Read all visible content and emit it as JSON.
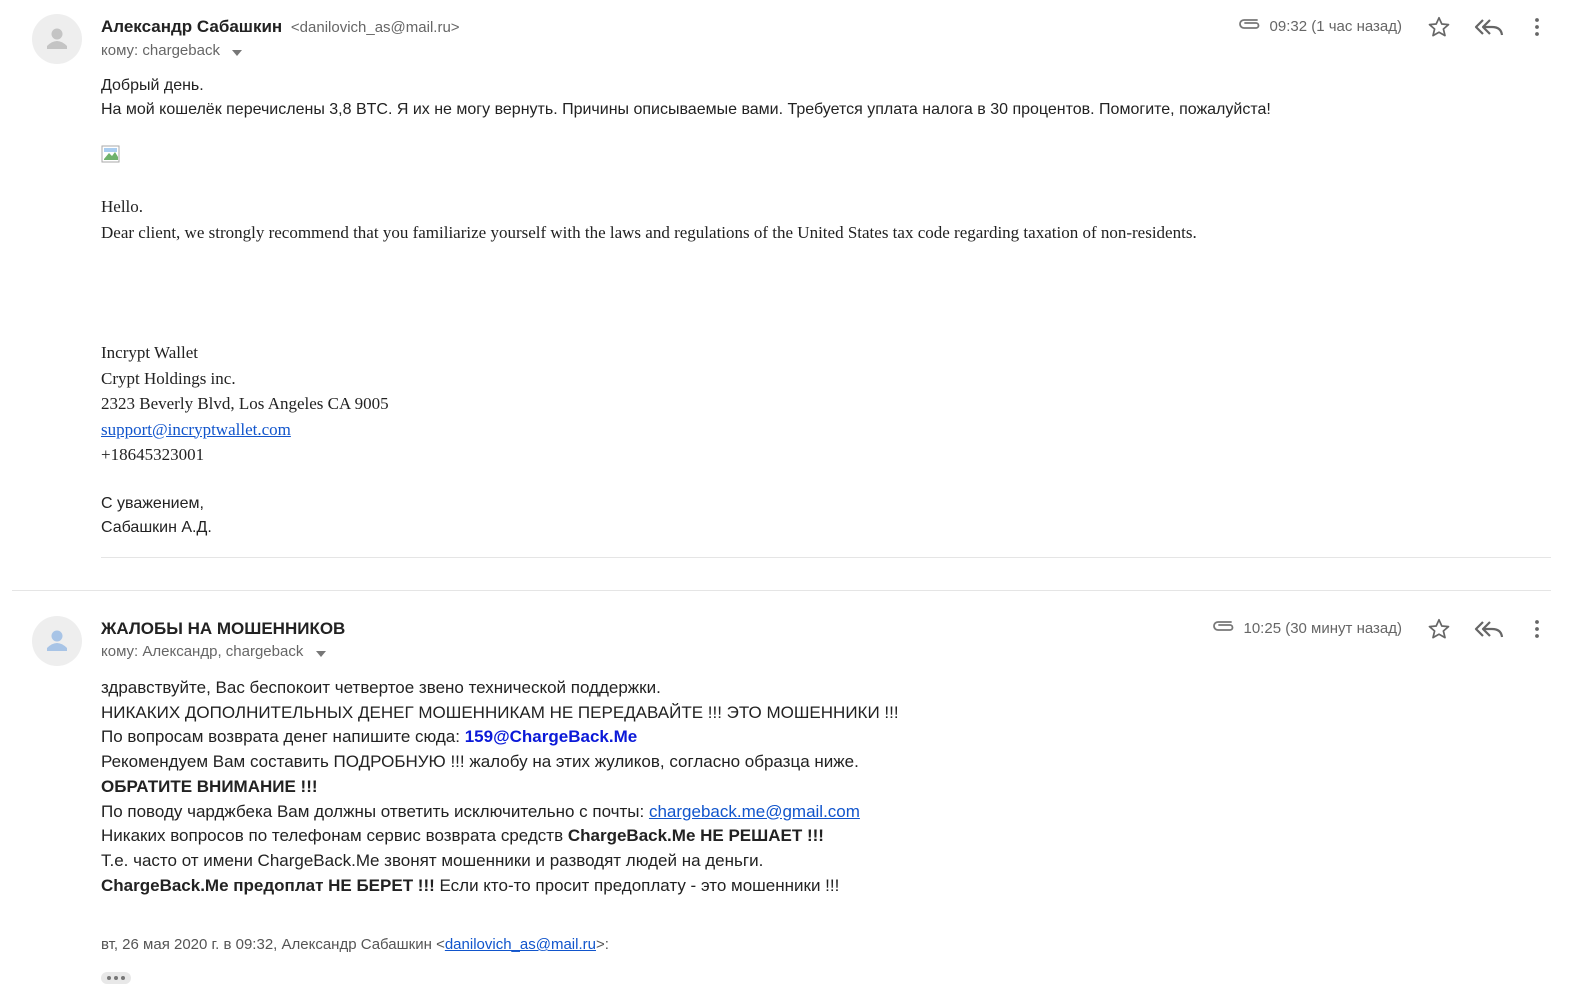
{
  "messages": [
    {
      "sender_name": "Александр Сабашкин",
      "sender_email": "<danilovich_as@mail.ru>",
      "recipients": "кому: chargeback",
      "time": "09:32 (1 час назад)",
      "body_ru": [
        "Добрый день.",
        "На мой кошелёк перечислены 3,8 BTC. Я их не могу вернуть. Причины описываемые вами. Требуется уплата налога в 30 процентов. Помогите, пожалуйста!"
      ],
      "body_en": [
        "Hello.",
        "Dear client, we strongly recommend that you familiarize yourself with the laws and regulations of the United States tax code regarding taxation of non-residents."
      ],
      "signature": {
        "company": "Incrypt Wallet",
        "holding": "Crypt Holdings inc.",
        "address": "2323 Beverly Blvd, Los Angeles CA 9005",
        "email": "support@incryptwallet.com",
        "phone": "+18645323001"
      },
      "closing": [
        "С уважением,",
        "Сабашкин А.Д."
      ]
    },
    {
      "sender_name": "ЖАЛОБЫ НА МОШЕННИКОВ",
      "recipients": "кому: Александр, chargeback",
      "time": "10:25 (30 минут назад)",
      "lines": {
        "l1": "здравствуйте, Вас беспокоит четвертое звено технической поддержки.",
        "l2": "НИКАКИХ ДОПОЛНИТЕЛЬНЫХ ДЕНЕГ МОШЕННИКАМ НЕ ПЕРЕДАВАЙТЕ !!! ЭТО МОШЕННИКИ !!!",
        "l3_a": "По вопросам возврата денег напишите сюда: ",
        "l3_b": "159@ChargeBack.Me",
        "l4": "Рекомендуем Вам составить ПОДРОБНУЮ !!! жалобу на этих жуликов, согласно образца ниже.",
        "l5": "ОБРАТИТЕ ВНИМАНИЕ !!!",
        "l6_a": "По поводу чарджбека Вам должны ответить исключительно с почты: ",
        "l6_b": "chargeback.me@gmail.com",
        "l7_a": "Никаких вопросов по телефонам сервис возврата средств ",
        "l7_b": "ChargeBack.Me НЕ РЕШАЕТ !!!",
        "l8": "Т.е. часто от имени ChargeBack.Me звонят мошенники и разводят людей на деньги.",
        "l9_a": "ChargeBack.Me предоплат НЕ БЕРЕТ !!!",
        "l9_b": " Если кто-то просит предоплату - это мошенники !!!"
      },
      "quote": {
        "prefix": "вт, 26 мая 2020 г. в 09:32, Александр Сабашкин <",
        "email": "danilovich_as@mail.ru",
        "suffix": ">:"
      }
    }
  ],
  "icons": {
    "attachment": "paperclip-icon",
    "star": "star-icon",
    "reply_all": "reply-all-icon",
    "more": "more-vert-icon"
  }
}
